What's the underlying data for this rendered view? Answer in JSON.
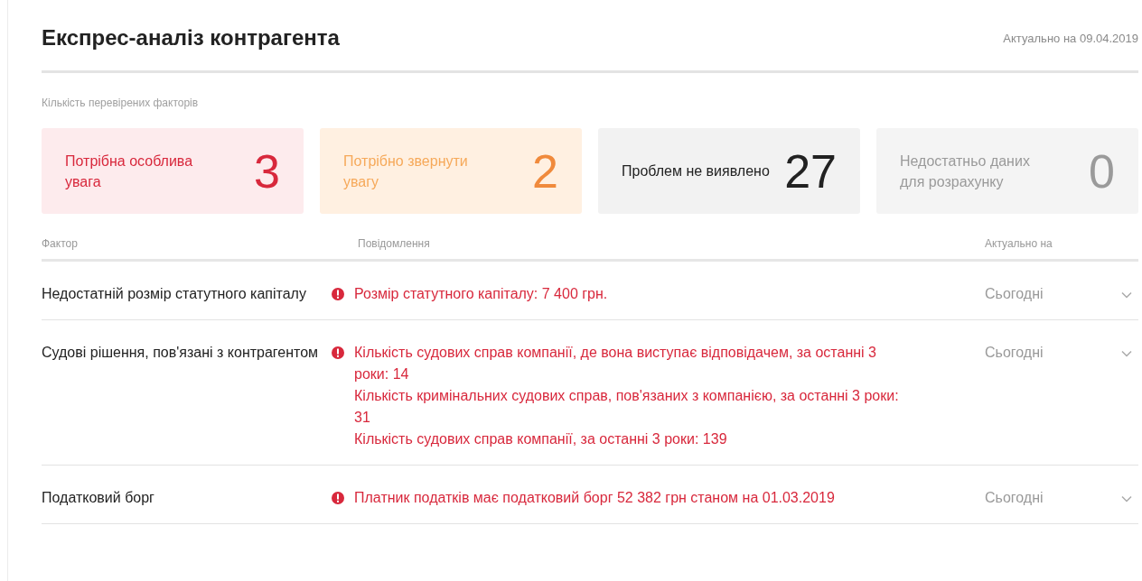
{
  "header": {
    "title": "Експрес-аналіз контрагента",
    "updated": "Актуально на 09.04.2019"
  },
  "summary": {
    "caption": "Кількість перевірених факторів",
    "cards": [
      {
        "kind": "critical",
        "label": "Потрібна особлива увага",
        "count": "3"
      },
      {
        "kind": "warning",
        "label": "Потрібно звернути увагу",
        "count": "2"
      },
      {
        "kind": "ok",
        "label": "Проблем не виявлено",
        "count": "27"
      },
      {
        "kind": "nodata",
        "label": "Недостатньо даних для розрахунку",
        "count": "0"
      }
    ]
  },
  "table": {
    "columns": [
      "Фактор",
      "Повідомлення",
      "Актуально на"
    ],
    "rows": [
      {
        "factor": "Недостатній розмір статутного капіталу",
        "messages": [
          "Розмір статутного капіталу: 7 400 грн."
        ],
        "date": "Сьогодні",
        "expanded": false
      },
      {
        "factor": "Судові рішення, пов'язані з контрагентом",
        "messages": [
          "Кількість судових справ компанії, де вона виступає відповідачем, за останні 3 роки: 14",
          "Кількість кримінальних судових справ, пов'язаних з компанією, за останні 3 роки: 31",
          "Кількість судових справ компанії, за останні 3 роки: 139"
        ],
        "date": "Сьогодні",
        "expanded": false
      },
      {
        "factor": "Податковий борг",
        "messages": [
          "Платник податків має податковий борг 52 382 грн станом на 01.03.2019"
        ],
        "date": "Сьогодні",
        "expanded": false
      }
    ]
  }
}
